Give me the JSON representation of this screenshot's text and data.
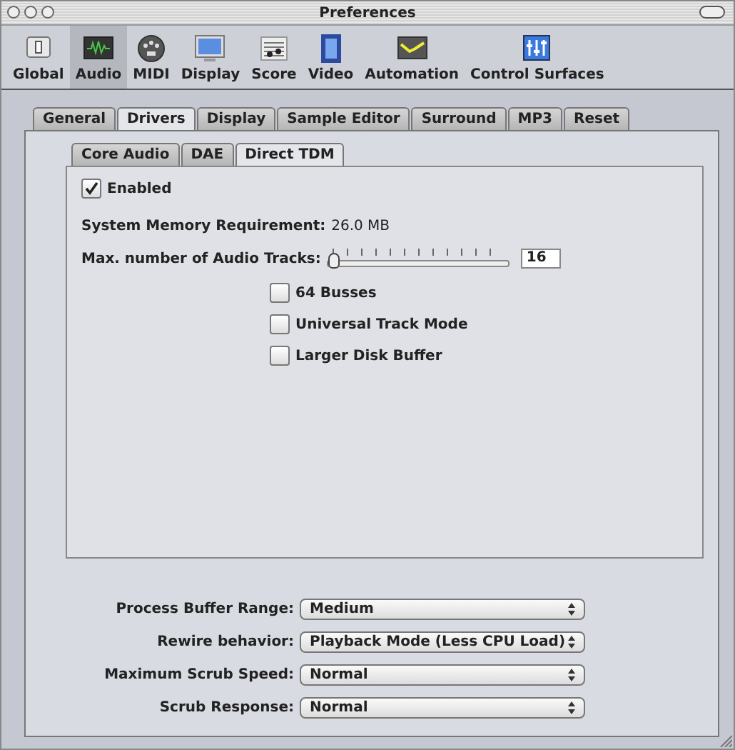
{
  "window": {
    "title": "Preferences"
  },
  "toolbar": [
    {
      "label": "Global",
      "selected": false
    },
    {
      "label": "Audio",
      "selected": true
    },
    {
      "label": "MIDI",
      "selected": false
    },
    {
      "label": "Display",
      "selected": false
    },
    {
      "label": "Score",
      "selected": false
    },
    {
      "label": "Video",
      "selected": false
    },
    {
      "label": "Automation",
      "selected": false
    },
    {
      "label": "Control Surfaces",
      "selected": false
    }
  ],
  "tabs": [
    {
      "label": "General",
      "selected": false
    },
    {
      "label": "Drivers",
      "selected": true
    },
    {
      "label": "Display",
      "selected": false
    },
    {
      "label": "Sample Editor",
      "selected": false
    },
    {
      "label": "Surround",
      "selected": false
    },
    {
      "label": "MP3",
      "selected": false
    },
    {
      "label": "Reset",
      "selected": false
    }
  ],
  "subtabs": [
    {
      "label": "Core Audio",
      "selected": false
    },
    {
      "label": "DAE",
      "selected": false
    },
    {
      "label": "Direct TDM",
      "selected": true
    }
  ],
  "enabled": {
    "label": "Enabled",
    "checked": true
  },
  "memory": {
    "label": "System Memory Requirement:",
    "value": "26.0 MB"
  },
  "tracks": {
    "label": "Max. number of Audio Tracks:",
    "level": 0.02,
    "value": "16"
  },
  "options": [
    {
      "label": "64 Busses",
      "checked": false
    },
    {
      "label": "Universal Track Mode",
      "checked": false
    },
    {
      "label": "Larger Disk Buffer",
      "checked": false
    }
  ],
  "popups": [
    {
      "label": "Process Buffer Range:",
      "value": "Medium"
    },
    {
      "label": "Rewire behavior:",
      "value": "Playback Mode (Less CPU Load)"
    },
    {
      "label": "Maximum Scrub Speed:",
      "value": "Normal"
    },
    {
      "label": "Scrub Response:",
      "value": "Normal"
    }
  ]
}
